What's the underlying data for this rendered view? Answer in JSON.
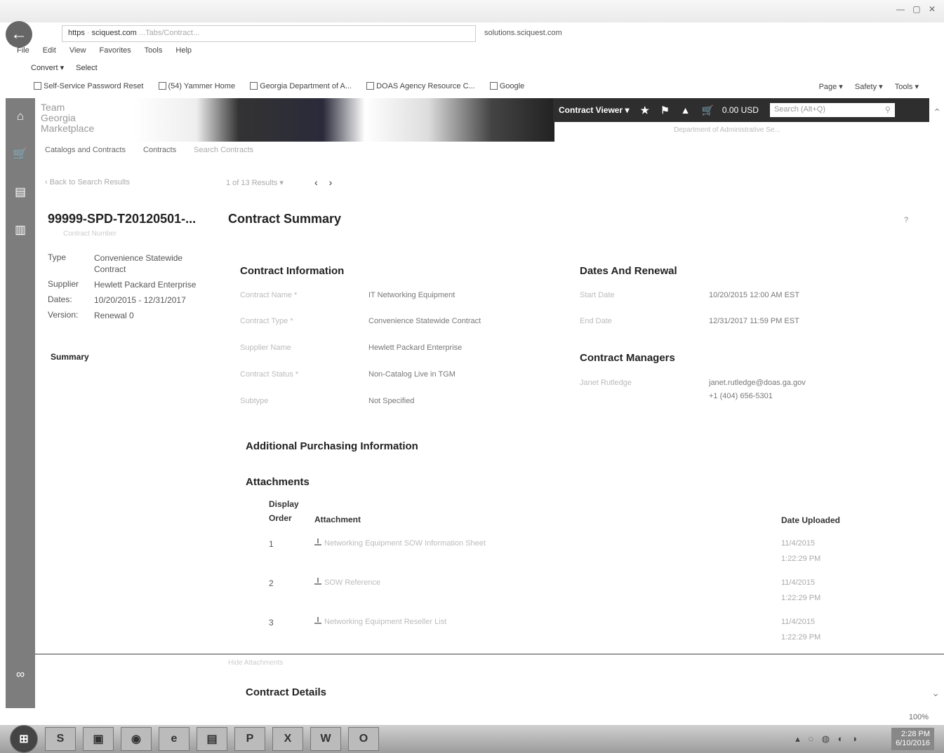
{
  "browser": {
    "url_scheme": "https",
    "url_host": "sciquest.com",
    "url_rest": "...Tabs/Contract...",
    "tab_title": "solutions.sciquest.com",
    "window_controls": "— ▢ ✕",
    "menu": [
      "File",
      "Edit",
      "View",
      "Favorites",
      "Tools",
      "Help"
    ],
    "command_bar": [
      "Convert ▾",
      "Select"
    ],
    "favorites": [
      "Self-Service Password Reset",
      "(54) Yammer Home",
      "Georgia Department of A...",
      "DOAS Agency Resource C...",
      "Google"
    ],
    "tools_right": [
      "Page ▾",
      "Safety ▾",
      "Tools ▾"
    ]
  },
  "header": {
    "logo_lines": [
      "Team",
      "Georgia",
      "Marketplace"
    ],
    "contract_viewer": "Contract Viewer ▾",
    "cart_total": "0.00 USD",
    "search_placeholder": "Search (Alt+Q)",
    "sub_info": "Department of Administrative Se..."
  },
  "breadcrumb_tabs": [
    "Catalogs and Contracts",
    "Contracts",
    "Search Contracts"
  ],
  "nav": {
    "back_link": "‹ Back to Search Results",
    "results": "1 of 13 Results ▾",
    "prev": "‹",
    "next": "›"
  },
  "contract": {
    "id": "99999-SPD-T20120501-...",
    "id_sub": "Contract Number",
    "page_title": "Contract Summary",
    "help": "?",
    "meta": [
      {
        "k": "Type",
        "v": "Convenience Statewide Contract"
      },
      {
        "k": "Supplier",
        "v": "Hewlett Packard Enterprise"
      },
      {
        "k": "Dates:",
        "v": "10/20/2015 - 12/31/2017"
      },
      {
        "k": "Version:",
        "v": "Renewal 0"
      }
    ],
    "summary_link": "Summary"
  },
  "contract_information": {
    "heading": "Contract Information",
    "fields": [
      {
        "label": "Contract Name *",
        "value": "IT Networking Equipment"
      },
      {
        "label": "Contract Type *",
        "value": "Convenience Statewide Contract"
      },
      {
        "label": "Supplier Name",
        "value": "Hewlett Packard Enterprise"
      },
      {
        "label": "Contract Status *",
        "value": "Non-Catalog Live in TGM"
      },
      {
        "label": "Subtype",
        "value": "Not Specified"
      }
    ]
  },
  "dates_renewal": {
    "heading": "Dates And Renewal",
    "fields": [
      {
        "label": "Start Date",
        "value": "10/20/2015 12:00 AM EST"
      },
      {
        "label": "End Date",
        "value": "12/31/2017 11:59 PM EST"
      }
    ]
  },
  "contract_managers": {
    "heading": "Contract Managers",
    "label": "Janet Rutledge",
    "email": "janet.rutledge@doas.ga.gov",
    "phone": "+1 (404) 656-5301"
  },
  "additional_purchasing": {
    "heading": "Additional Purchasing Information"
  },
  "attachments": {
    "heading": "Attachments",
    "col_order_1": "Display",
    "col_order_2": "Order",
    "col_attachment": "Attachment",
    "col_date": "Date Uploaded",
    "rows": [
      {
        "order": "1",
        "name": "Networking Equipment SOW Information Sheet",
        "date": "11/4/2015",
        "time": "1:22:29 PM"
      },
      {
        "order": "2",
        "name": "SOW Reference",
        "date": "11/4/2015",
        "time": "1:22:29 PM"
      },
      {
        "order": "3",
        "name": "Networking Equipment Reseller List",
        "date": "11/4/2015",
        "time": "1:22:29 PM"
      }
    ]
  },
  "under_divider": "Hide Attachments",
  "contract_details": {
    "heading": "Contract Details"
  },
  "zoom": "100%",
  "taskbar": {
    "apps": [
      "S",
      "▣",
      "◉",
      "e",
      "▤",
      "P",
      "X",
      "W",
      "O"
    ],
    "time": "2:28 PM",
    "date": "6/10/2016"
  }
}
